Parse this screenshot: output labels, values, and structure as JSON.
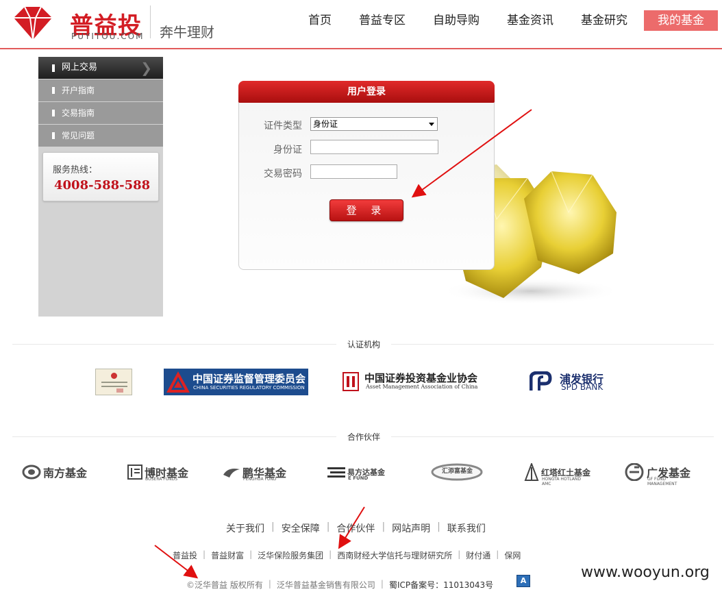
{
  "header": {
    "logo_text": "普益投",
    "logo_sub": "PUYITOU.COM",
    "slogan": "奔牛理财",
    "nav": [
      "首页",
      "普益专区",
      "自助导购",
      "基金资讯",
      "基金研究"
    ],
    "nav_active": "我的基金"
  },
  "sidebar": {
    "header": "网上交易",
    "items": [
      "开户指南",
      "交易指南",
      "常见问题"
    ],
    "hotline_label": "服务热线：",
    "hotline_number": "4008-588-588"
  },
  "login": {
    "title": "用户登录",
    "id_type_label": "证件类型",
    "id_type_value": "身份证",
    "id_label": "身份证",
    "id_value": "",
    "password_label": "交易密码",
    "password_value": "",
    "submit_label": "登 录"
  },
  "certifications": {
    "title": "认证机构",
    "items": [
      {
        "name": "中国证券监督管理委员会",
        "sub": "CHINA SECURITIES REGULATORY COMMISSION"
      },
      {
        "name": "中国证券投资基金业协会",
        "sub": "Asset Management Association of China"
      },
      {
        "name": "浦发银行",
        "sub": "SPD BANK"
      }
    ]
  },
  "partners": {
    "title": "合作伙伴",
    "items": [
      {
        "name": "南方基金",
        "sub": ""
      },
      {
        "name": "博时基金",
        "sub": "BOSERA FUNDS"
      },
      {
        "name": "鹏华基金",
        "sub": "PENGHUA FUND"
      },
      {
        "name": "易方达基金",
        "sub": "E FUND"
      },
      {
        "name": "汇添富基金",
        "sub": ""
      },
      {
        "name": "红塔红土基金",
        "sub": "HONGTA HOTLAND AMC"
      },
      {
        "name": "广发基金",
        "sub": "GF FUND MANAGEMENT"
      }
    ]
  },
  "footer": {
    "links": [
      "关于我们",
      "安全保障",
      "合作伙伴",
      "网站声明",
      "联系我们"
    ],
    "friends": [
      "普益投",
      "普益财富",
      "泛华保险服务集团",
      "西南财经大学信托与理财研究所",
      "财付通",
      "保网"
    ],
    "copyright": "©泛华普益 版权所有",
    "company": "泛华普益基金销售有限公司",
    "icp": "蜀ICP备案号：11013043号",
    "badge": "A"
  },
  "watermark": "www.wooyun.org",
  "colors": {
    "brand_red": "#d31d24",
    "nav_active_bg": "#ec6b6b",
    "sidebar_bg": "#d3d3d3"
  }
}
